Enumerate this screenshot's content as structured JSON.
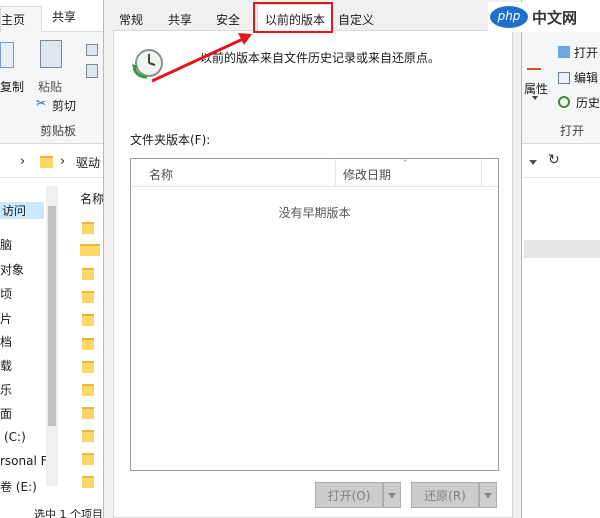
{
  "explorer": {
    "ribbon_tabs": [
      "主页",
      "共享"
    ],
    "ribbon_left": {
      "copy": "复制",
      "paste": "粘贴",
      "cut": "剪切",
      "clipboard_group": "剪贴板"
    },
    "ribbon_right": {
      "open": "打开",
      "edit": "编辑",
      "history": "历史",
      "properties": "属性",
      "open_group": "打开"
    },
    "address": "驱动",
    "column_name": "名称",
    "nav_items": [
      "访问",
      "脑",
      "对象",
      "顷",
      "片",
      "档",
      "载",
      "乐",
      "面",
      "(C:)",
      "rsonal F",
      "卷 (E:)"
    ],
    "status": "选中 1 个项目"
  },
  "dialog": {
    "tabs": [
      "常规",
      "共享",
      "安全",
      "以前的版本",
      "自定义"
    ],
    "active_tab": "以前的版本",
    "intro": "以前的版本来自文件历史记录或来自还原点。",
    "folder_versions_label": "文件夹版本(F):",
    "columns": [
      "名称",
      "修改日期"
    ],
    "empty_text": "没有早期版本",
    "buttons": {
      "open": "打开(O)",
      "restore": "还原(R)"
    }
  },
  "annotation_color": "#e3161c",
  "watermark": {
    "logo": "php",
    "text": "中文网"
  }
}
